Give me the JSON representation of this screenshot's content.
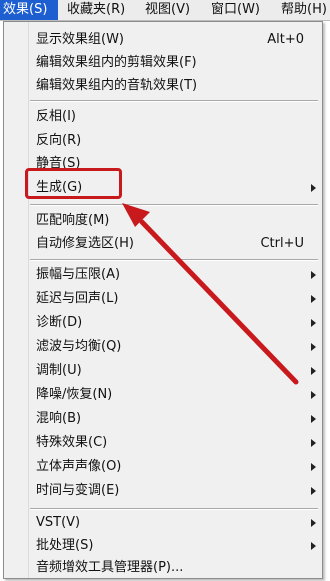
{
  "menubar": {
    "items": [
      {
        "label": "效果(S)",
        "active": true
      },
      {
        "label": "收藏夹(R)",
        "active": false
      },
      {
        "label": "视图(V)",
        "active": false
      },
      {
        "label": "窗口(W)",
        "active": false
      },
      {
        "label": "帮助(H)",
        "active": false
      }
    ]
  },
  "menu": {
    "items": [
      {
        "label": "显示效果组(W)",
        "shortcut": "Alt+0"
      },
      {
        "label": "编辑效果组内的剪辑效果(F)"
      },
      {
        "label": "编辑效果组内的音轨效果(T)"
      },
      {
        "label": "反相(I)"
      },
      {
        "label": "反向(R)"
      },
      {
        "label": "静音(S)"
      },
      {
        "label": "生成(G)",
        "submenu": true
      },
      {
        "label": "匹配响度(M)"
      },
      {
        "label": "自动修复选区(H)",
        "shortcut": "Ctrl+U"
      },
      {
        "label": "振幅与压限(A)",
        "submenu": true
      },
      {
        "label": "延迟与回声(L)",
        "submenu": true
      },
      {
        "label": "诊断(D)",
        "submenu": true
      },
      {
        "label": "滤波与均衡(Q)",
        "submenu": true
      },
      {
        "label": "调制(U)",
        "submenu": true
      },
      {
        "label": "降噪/恢复(N)",
        "submenu": true
      },
      {
        "label": "混响(B)",
        "submenu": true
      },
      {
        "label": "特殊效果(C)",
        "submenu": true
      },
      {
        "label": "立体声声像(O)",
        "submenu": true
      },
      {
        "label": "时间与变调(E)",
        "submenu": true
      },
      {
        "label": "VST(V)",
        "submenu": true
      },
      {
        "label": "批处理(S)",
        "submenu": true
      },
      {
        "label": "音频增效工具管理器(P)...",
        "submenu": false
      }
    ]
  },
  "annotation": {
    "highlight_color": "#c8191d",
    "arrow_color": "#c8191d"
  },
  "colors": {
    "menu_bg": "#f0f0f0",
    "active_menubar_bg": "#1d5fd0"
  }
}
